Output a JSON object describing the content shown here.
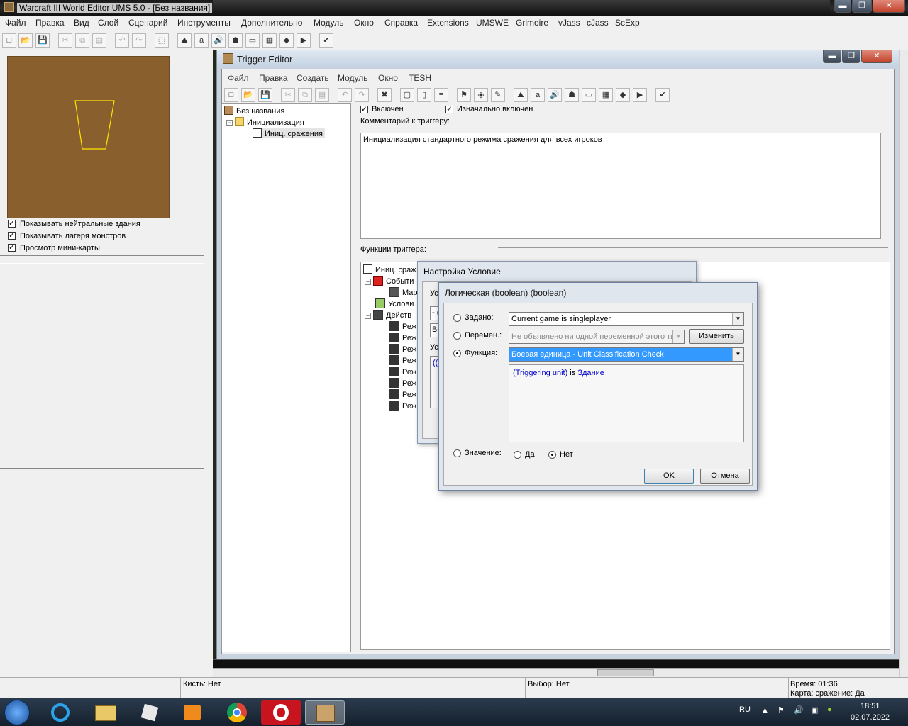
{
  "app": {
    "title": "Warcraft III World Editor UMS 5.0 - [Без названия]",
    "menu": [
      "Файл",
      "Правка",
      "Вид",
      "Слой",
      "Сценарий",
      "Инструменты",
      "Дополнительно",
      "Модуль",
      "Окно",
      "Справка",
      "Extensions",
      "UMSWE",
      "Grimoire",
      "vJass",
      "cJass",
      "ScExp"
    ],
    "window_controls": {
      "minimize": "▬",
      "restore": "❐",
      "close": "✕"
    }
  },
  "left_panel": {
    "checkboxes": [
      {
        "label": "Показывать нейтральные здания",
        "checked": true
      },
      {
        "label": "Показывать лагеря монстров",
        "checked": true
      },
      {
        "label": "Просмотр мини-карты",
        "checked": true
      }
    ],
    "minimap_color": "#8a5f2e"
  },
  "trigger_editor": {
    "title": "Trigger Editor",
    "menu": [
      "Файл",
      "Правка",
      "Создать",
      "Модуль",
      "Окно",
      "TESH"
    ],
    "window_controls": {
      "minimize": "▬",
      "restore": "❐",
      "close": "✕"
    },
    "tree": {
      "root": "Без названия",
      "category": "Инициализация",
      "trigger": "Иниц. сражения"
    },
    "enabled_label": "Включен",
    "initially_on_label": "Изначально включен",
    "comment_label": "Комментарий к триггеру:",
    "comment": "Инициализация стандартного режима сражения для всех игроков",
    "functions_label": "Функции триггера:",
    "functions": {
      "trigger": "Иниц. сраж",
      "events": "Событи",
      "event_item": "Мар",
      "conditions": "Услови",
      "actions": "Действ",
      "action_items": [
        "Реж",
        "Реж",
        "Реж",
        "Реж",
        "Реж",
        "Реж",
        "Реж",
        "Реж"
      ]
    }
  },
  "condition_dialog": {
    "title": "Настройка Условие",
    "partial_labels": [
      "Ус",
      "- (",
      "Во",
      "Ус",
      "(("
    ]
  },
  "boolean_dialog": {
    "title": "Логическая (boolean) (boolean)",
    "preset_label": "Задано:",
    "preset_value": "Current game is singleplayer",
    "variable_label": "Перемен.:",
    "variable_value": "Не объявлено ни одной переменной этого ти",
    "edit_button": "Изменить",
    "function_label": "Функция:",
    "function_value": "Боевая единица - Unit Classification Check",
    "function_text": {
      "arg1": "(Triggering unit)",
      "word": "is",
      "arg2": "Здание"
    },
    "value_label": "Значение:",
    "yes_label": "Да",
    "no_label": "Нет",
    "selected": "function",
    "value_selected": "no",
    "ok_button": "OK",
    "cancel_button": "Отмена"
  },
  "status_bar": {
    "brush": "Кисть: Нет",
    "selection": "Выбор: Нет",
    "time": "Время: 01:36",
    "map": "Карта: сражение: Да"
  },
  "taskbar": {
    "lang": "RU",
    "clock_time": "18:51",
    "clock_date": "02.07.2022"
  }
}
